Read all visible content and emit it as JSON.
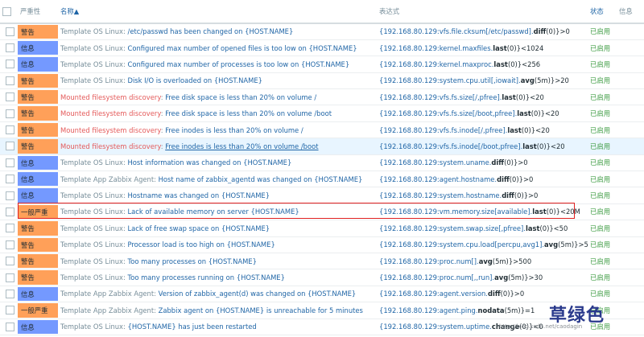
{
  "header": {
    "severity": "严重性",
    "name": "名称▲",
    "expression": "表达式",
    "status": "状态",
    "info": "信息"
  },
  "rows": [
    {
      "severity": "警告",
      "sev": "warning",
      "prefix": "Template OS Linux",
      "prefix_type": "tpl",
      "name": "/etc/passwd has been changed on {HOST.NAME}",
      "host": "{192.168.80.129:vfs.file.cksum[/etc/passwd].",
      "fn": "diff",
      "tail": "(0)}>0",
      "status": "已启用"
    },
    {
      "severity": "信息",
      "sev": "info",
      "prefix": "Template OS Linux",
      "prefix_type": "tpl",
      "name": "Configured max number of opened files is too low on {HOST.NAME}",
      "host": "{192.168.80.129:kernel.maxfiles.",
      "fn": "last",
      "tail": "(0)}<1024",
      "status": "已启用"
    },
    {
      "severity": "信息",
      "sev": "info",
      "prefix": "Template OS Linux",
      "prefix_type": "tpl",
      "name": "Configured max number of processes is too low on {HOST.NAME}",
      "host": "{192.168.80.129:kernel.maxproc.",
      "fn": "last",
      "tail": "(0)}<256",
      "status": "已启用"
    },
    {
      "severity": "警告",
      "sev": "warning",
      "prefix": "Template OS Linux",
      "prefix_type": "tpl",
      "name": "Disk I/O is overloaded on {HOST.NAME}",
      "host": "{192.168.80.129:system.cpu.util[,iowait].",
      "fn": "avg",
      "tail": "(5m)}>20",
      "status": "已启用"
    },
    {
      "severity": "警告",
      "sev": "warning",
      "prefix": "Mounted filesystem discovery",
      "prefix_type": "disc",
      "name": "Free disk space is less than 20% on volume /",
      "host": "{192.168.80.129:vfs.fs.size[/,pfree].",
      "fn": "last",
      "tail": "(0)}<20",
      "status": "已启用"
    },
    {
      "severity": "警告",
      "sev": "warning",
      "prefix": "Mounted filesystem discovery",
      "prefix_type": "disc",
      "name": "Free disk space is less than 20% on volume /boot",
      "host": "{192.168.80.129:vfs.fs.size[/boot,pfree].",
      "fn": "last",
      "tail": "(0)}<20",
      "status": "已启用"
    },
    {
      "severity": "警告",
      "sev": "warning",
      "prefix": "Mounted filesystem discovery",
      "prefix_type": "disc",
      "name": "Free inodes is less than 20% on volume /",
      "host": "{192.168.80.129:vfs.fs.inode[/,pfree].",
      "fn": "last",
      "tail": "(0)}<20",
      "status": "已启用"
    },
    {
      "severity": "警告",
      "sev": "warning",
      "prefix": "Mounted filesystem discovery",
      "prefix_type": "disc",
      "name": "Free inodes is less than 20% on volume /boot",
      "host": "{192.168.80.129:vfs.fs.inode[/boot,pfree].",
      "fn": "last",
      "tail": "(0)}<20",
      "status": "已启用",
      "hl": true
    },
    {
      "severity": "信息",
      "sev": "info",
      "prefix": "Template OS Linux",
      "prefix_type": "tpl",
      "name": "Host information was changed on {HOST.NAME}",
      "host": "{192.168.80.129:system.uname.",
      "fn": "diff",
      "tail": "(0)}>0",
      "status": "已启用"
    },
    {
      "severity": "信息",
      "sev": "info",
      "prefix": "Template App Zabbix Agent",
      "prefix_type": "tpl",
      "name": "Host name of zabbix_agentd was changed on {HOST.NAME}",
      "host": "{192.168.80.129:agent.hostname.",
      "fn": "diff",
      "tail": "(0)}>0",
      "status": "已启用"
    },
    {
      "severity": "信息",
      "sev": "info",
      "prefix": "Template OS Linux",
      "prefix_type": "tpl",
      "name": "Hostname was changed on {HOST.NAME}",
      "host": "{192.168.80.129:system.hostname.",
      "fn": "diff",
      "tail": "(0)}>0",
      "status": "已启用"
    },
    {
      "severity": "一般严重",
      "sev": "average",
      "prefix": "Template OS Linux",
      "prefix_type": "tpl",
      "name": "Lack of available memory on server {HOST.NAME}",
      "host": "{192.168.80.129:vm.memory.size[available].",
      "fn": "last",
      "tail": "(0)}<20M",
      "status": "已启用"
    },
    {
      "severity": "警告",
      "sev": "warning",
      "prefix": "Template OS Linux",
      "prefix_type": "tpl",
      "name": "Lack of free swap space on {HOST.NAME}",
      "host": "{192.168.80.129:system.swap.size[,pfree].",
      "fn": "last",
      "tail": "(0)}<50",
      "status": "已启用"
    },
    {
      "severity": "警告",
      "sev": "warning",
      "prefix": "Template OS Linux",
      "prefix_type": "tpl",
      "name": "Processor load is too high on {HOST.NAME}",
      "host": "{192.168.80.129:system.cpu.load[percpu,avg1].",
      "fn": "avg",
      "tail": "(5m)}>5",
      "status": "已启用"
    },
    {
      "severity": "警告",
      "sev": "warning",
      "prefix": "Template OS Linux",
      "prefix_type": "tpl",
      "name": "Too many processes on {HOST.NAME}",
      "host": "{192.168.80.129:proc.num[].",
      "fn": "avg",
      "tail": "(5m)}>500",
      "status": "已启用"
    },
    {
      "severity": "警告",
      "sev": "warning",
      "prefix": "Template OS Linux",
      "prefix_type": "tpl",
      "name": "Too many processes running on {HOST.NAME}",
      "host": "{192.168.80.129:proc.num[,,run].",
      "fn": "avg",
      "tail": "(5m)}>30",
      "status": "已启用"
    },
    {
      "severity": "信息",
      "sev": "info",
      "prefix": "Template App Zabbix Agent",
      "prefix_type": "tpl",
      "name": "Version of zabbix_agent(d) was changed on {HOST.NAME}",
      "host": "{192.168.80.129:agent.version.",
      "fn": "diff",
      "tail": "(0)}>0",
      "status": "已启用"
    },
    {
      "severity": "一般严重",
      "sev": "average",
      "prefix": "Template App Zabbix Agent",
      "prefix_type": "tpl",
      "name": "Zabbix agent on {HOST.NAME} is unreachable for 5 minutes",
      "host": "{192.168.80.129:agent.ping.",
      "fn": "nodata",
      "tail": "(5m)}=1",
      "status": "已启用"
    },
    {
      "severity": "信息",
      "sev": "info",
      "prefix": "Template OS Linux",
      "prefix_type": "tpl",
      "name": "{HOST.NAME} has just been restarted",
      "host": "{192.168.80.129:system.uptime.",
      "fn": "change",
      "tail": "(0)}<0",
      "status": "已启用"
    }
  ],
  "highlight_row_index": 11,
  "watermark": "草绿色",
  "blog_url": "http://blog.csdn.net/caodagin",
  "colors": {
    "warning": "#ffa059",
    "info": "#7499ff",
    "average": "#ffa059",
    "enabled": "#429e47",
    "link": "#1f65a6"
  }
}
